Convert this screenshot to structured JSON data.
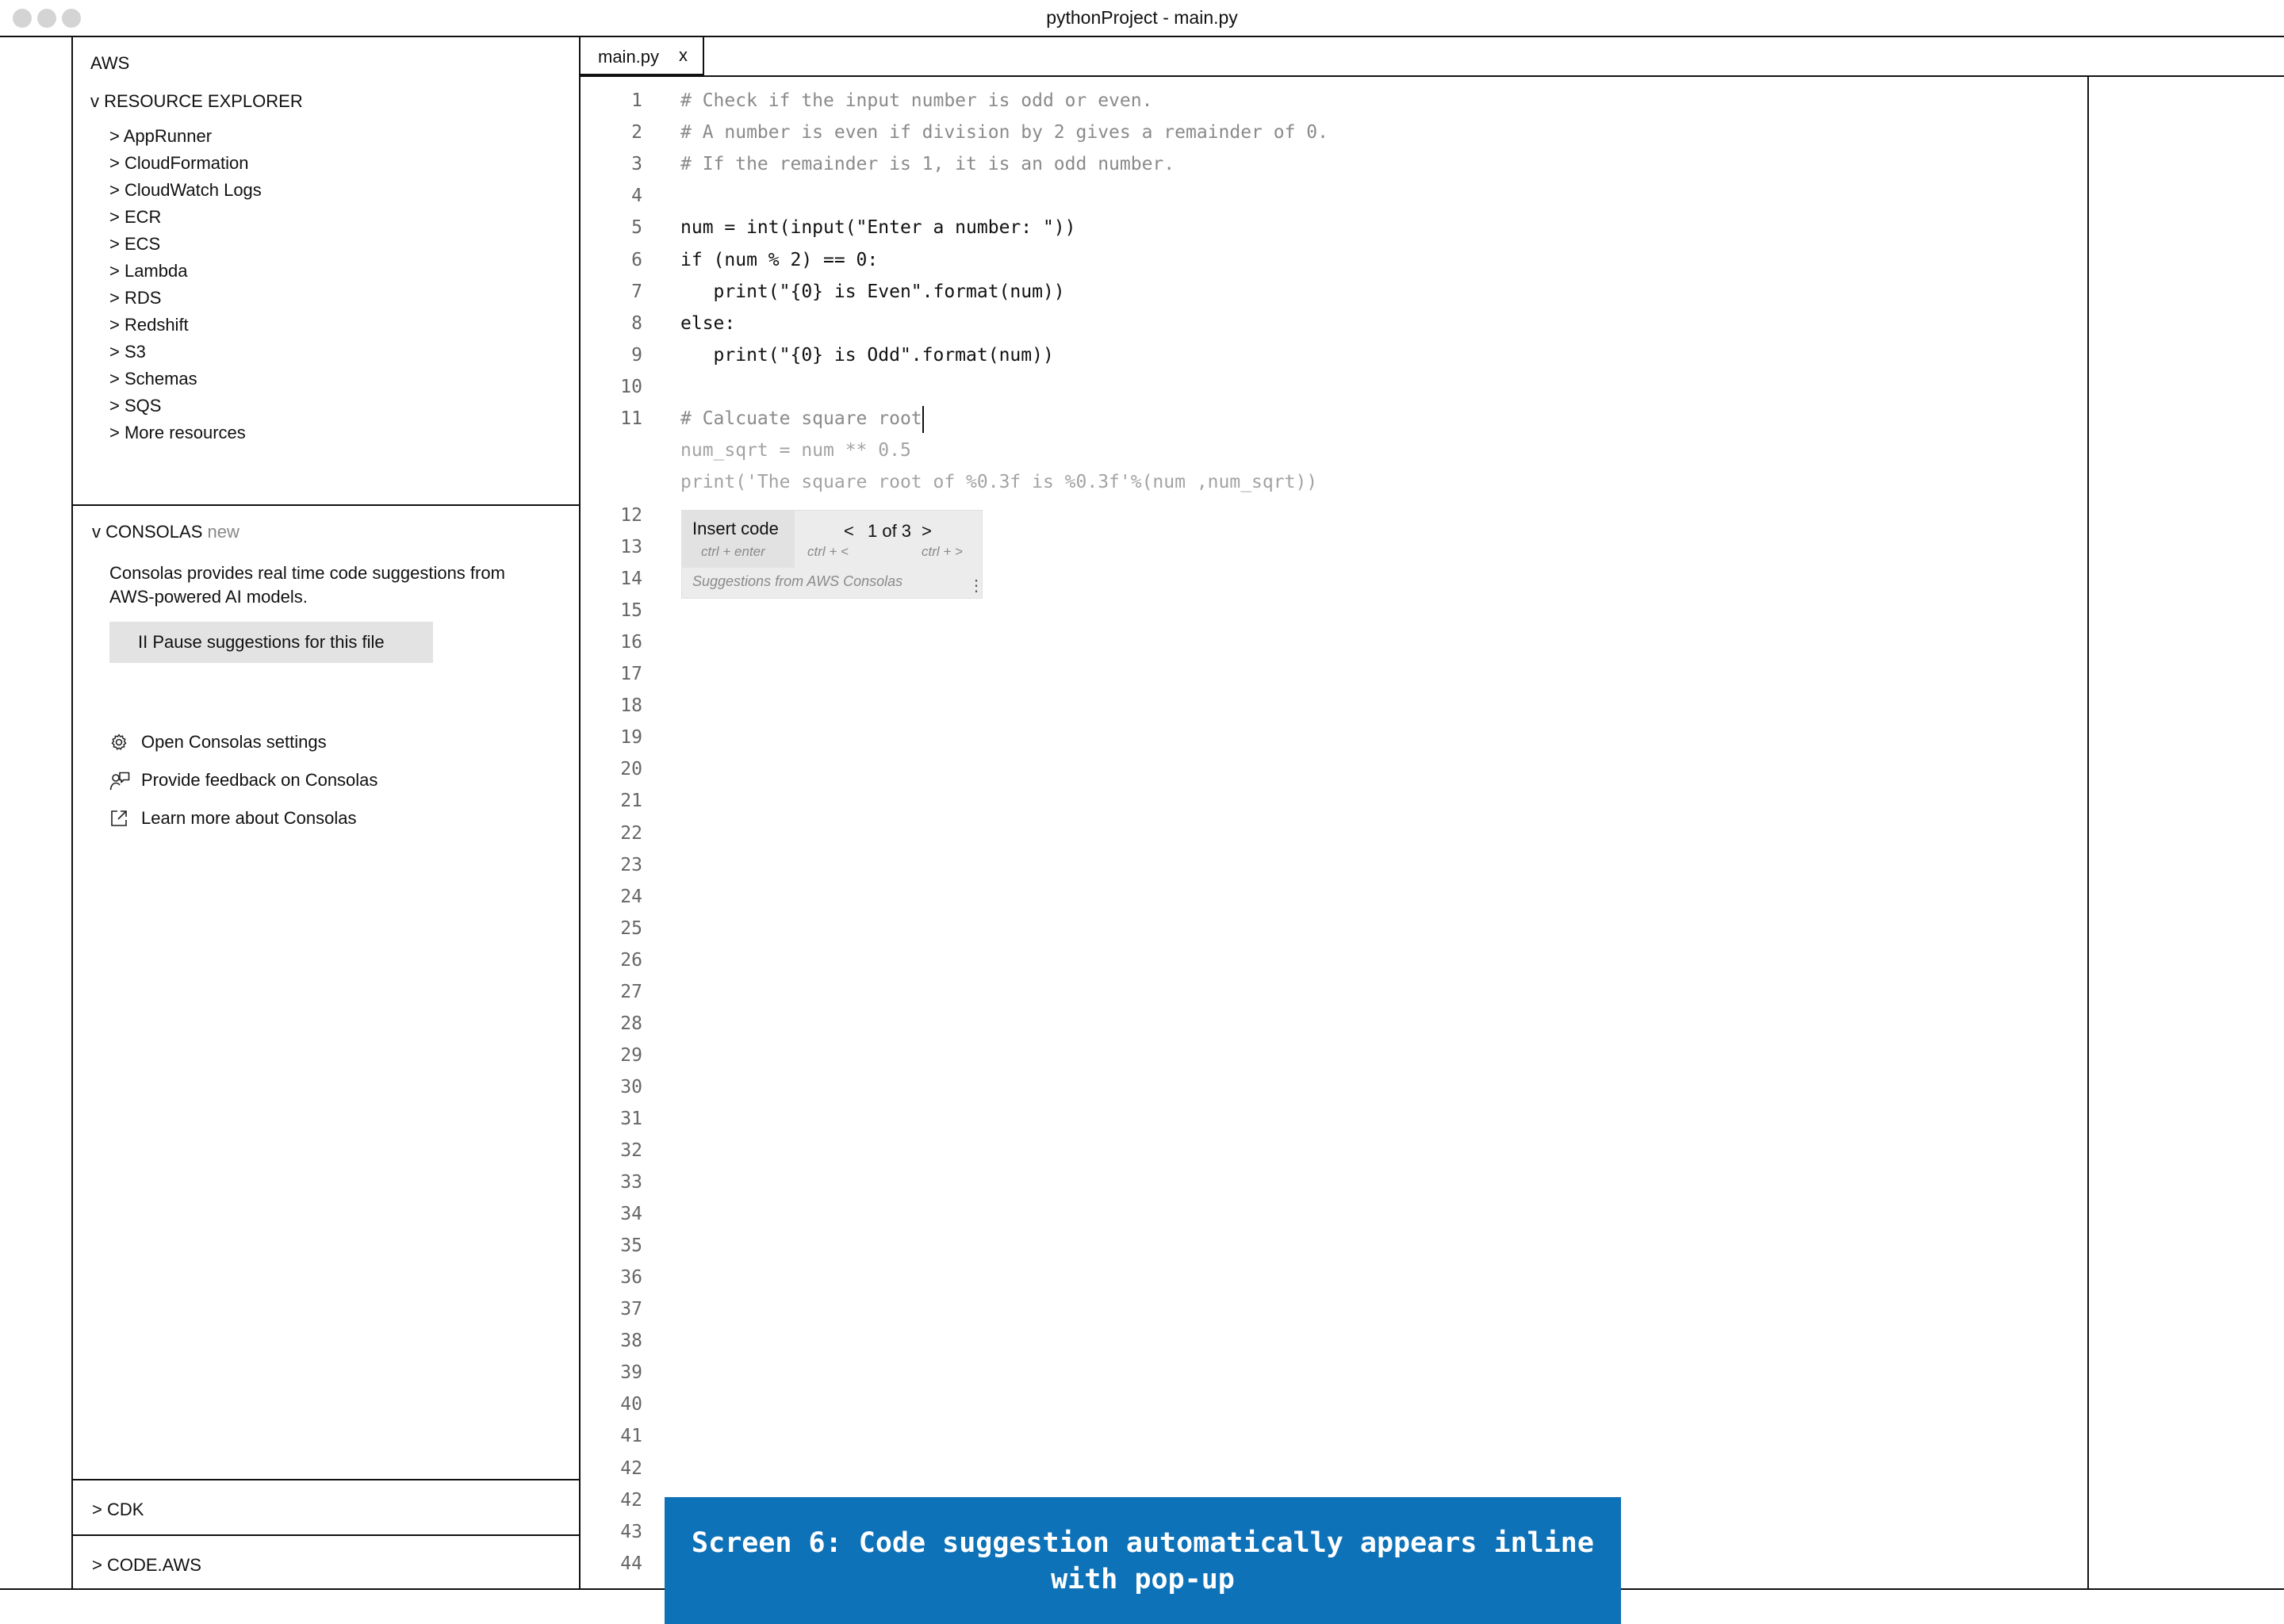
{
  "window": {
    "title": "pythonProject - main.py"
  },
  "sidebar": {
    "aws_label": "AWS",
    "resource_explorer": {
      "header": "v RESOURCE EXPLORER",
      "items": [
        "> AppRunner",
        "> CloudFormation",
        "> CloudWatch Logs",
        "> ECR",
        "> ECS",
        "> Lambda",
        "> RDS",
        "> Redshift",
        "> S3",
        "> Schemas",
        "> SQS",
        "> More resources"
      ]
    },
    "consolas": {
      "header": "v CONSOLAS",
      "badge": "new",
      "description": "Consolas provides real time code suggestions from AWS-powered AI models.",
      "pause_button": "II Pause suggestions for this file",
      "links": [
        {
          "label": "Open Consolas settings",
          "icon": "gear-icon"
        },
        {
          "label": "Provide feedback on Consolas",
          "icon": "feedback-icon"
        },
        {
          "label": "Learn more about Consolas",
          "icon": "external-link-icon"
        }
      ]
    },
    "cdk_label": "> CDK",
    "codeaws_label": "> CODE.AWS"
  },
  "editor": {
    "tab": {
      "label": "main.py",
      "close": "x"
    },
    "code_lines": [
      "# Check if the input number is odd or even.",
      "# A number is even if division by 2 gives a remainder of 0.",
      "# If the remainder is 1, it is an odd number.",
      "",
      "num = int(input(\"Enter a number: \"))",
      "if (num % 2) == 0:",
      "   print(\"{0} is Even\".format(num))",
      "else:",
      "   print(\"{0} is Odd\".format(num))",
      "",
      "# Calcuate square root"
    ],
    "ghost_suggestion": [
      "num_sqrt = num ** 0.5",
      "print('The square root of %0.3f is %0.3f'%(num ,num_sqrt))"
    ],
    "line_numbers_after": [
      "12",
      "13",
      "14",
      "15",
      "16",
      "17",
      "18",
      "19",
      "20",
      "21",
      "22",
      "23",
      "24",
      "25",
      "26",
      "27",
      "28",
      "29",
      "30",
      "31",
      "32",
      "33",
      "34",
      "35",
      "36",
      "37",
      "38",
      "39",
      "40",
      "41",
      "42",
      "42",
      "43",
      "44"
    ],
    "popup": {
      "insert_label": "Insert code",
      "insert_shortcut": "ctrl + enter",
      "prev": "<",
      "counter": "1 of 3",
      "next": ">",
      "prev_shortcut": "ctrl + <",
      "next_shortcut": "ctrl + >",
      "footer": "Suggestions from AWS Consolas",
      "menu": "⋮"
    }
  },
  "caption": {
    "line1": "Screen 6: Code suggestion automatically appears inline",
    "line2": "with pop-up"
  },
  "colors": {
    "caption_bg": "#0e72b8",
    "popup_bg": "#ececec",
    "comment": "#8a8a8a"
  }
}
